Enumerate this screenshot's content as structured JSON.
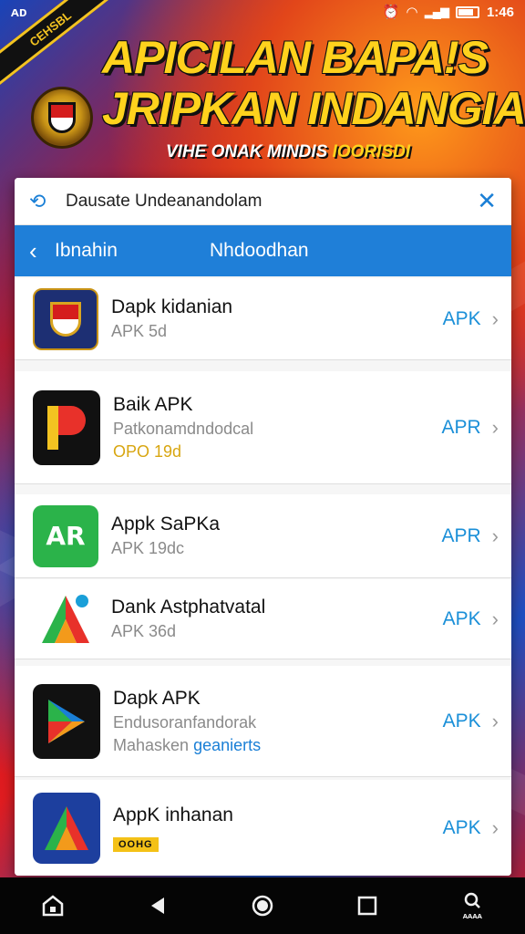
{
  "status_bar": {
    "left_text": "ᴀᴅ",
    "time": "1:46"
  },
  "banner": {
    "sash_text": "CEHSBL",
    "title_line1": "APICILAN BAPA!S",
    "title_line2": "JRIPKAN INDANGIA!",
    "subtitle_white": "VIHE ONAK MINDIS ",
    "subtitle_yellow": "IOORISDI"
  },
  "search": {
    "icon": "search-icon",
    "query": "Dausate Undeanandolam"
  },
  "nav": {
    "back_label": "Ibnahin",
    "title": "Nhdoodhan"
  },
  "apps": [
    {
      "name": "Dapk kidanian",
      "sub": "APK 5d",
      "action": "APK",
      "icon": "emblem-app-icon"
    },
    {
      "name": "Baik APK",
      "sub": "Patkonamdndodcal",
      "sub2": "OPO 19d",
      "action": "APR",
      "icon": "p-app-icon"
    },
    {
      "name": "Appk SaPKa",
      "sub": "APK 19dc",
      "action": "APR",
      "icon": "ar-app-icon"
    },
    {
      "name": "Dank Astphatvatal",
      "sub": "APK 36d",
      "action": "APK",
      "icon": "a-colorful-app-icon"
    },
    {
      "name": "Dapk APK",
      "sub": "Endusoranfandorak",
      "sub2_gray": "Mahasken ",
      "sub2_blue": "geanierts",
      "action": "APK",
      "icon": "play-app-icon"
    },
    {
      "name": "AppK inhanan",
      "badge": "OOHG",
      "action": "APK",
      "icon": "a-blue-app-icon"
    }
  ],
  "system_nav": {
    "right_label": "ᴀᴀᴀᴀ"
  },
  "colors": {
    "accent_blue": "#1f7fd8",
    "banner_yellow": "#ffd21d",
    "background_red": "#c8141c"
  }
}
